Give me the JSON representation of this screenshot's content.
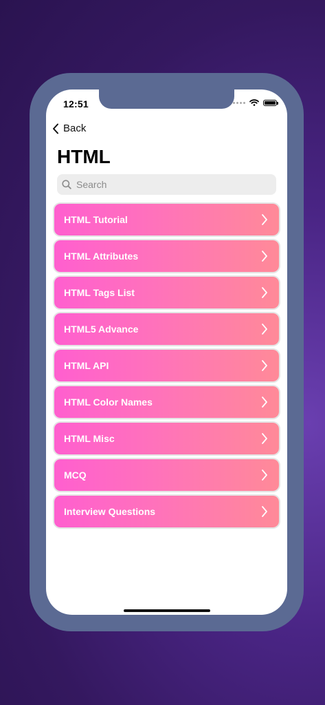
{
  "status_bar": {
    "time": "12:51"
  },
  "nav": {
    "back_label": "Back"
  },
  "page": {
    "title": "HTML"
  },
  "search": {
    "placeholder": "Search",
    "value": ""
  },
  "menu": {
    "items": [
      {
        "label": "HTML Tutorial"
      },
      {
        "label": "HTML Attributes"
      },
      {
        "label": "HTML Tags List"
      },
      {
        "label": "HTML5 Advance"
      },
      {
        "label": "HTML API"
      },
      {
        "label": "HTML Color Names"
      },
      {
        "label": "HTML Misc"
      },
      {
        "label": "MCQ"
      },
      {
        "label": "Interview Questions"
      }
    ]
  },
  "icons": {
    "back": "chevron-left-icon",
    "search": "search-icon",
    "item_arrow": "chevron-right-icon",
    "wifi": "wifi-icon",
    "battery": "battery-icon",
    "signal": "signal-icon"
  },
  "colors": {
    "background": "#3b1c6b",
    "device_frame": "#5b6a93",
    "item_gradient_start": "#ff5fcf",
    "item_gradient_end": "#ff8a98",
    "item_text": "#ffffff"
  }
}
